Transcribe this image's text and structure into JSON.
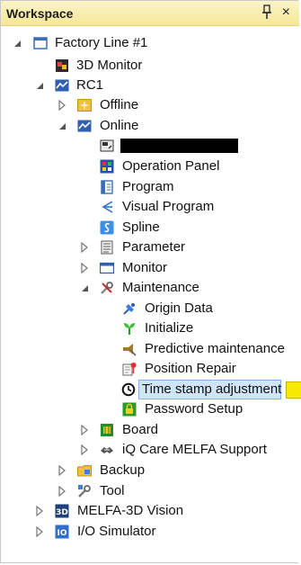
{
  "panel": {
    "title": "Workspace",
    "pin_icon": "pin-icon",
    "close_glyph": "×"
  },
  "tree": {
    "factory_line": "Factory Line #1",
    "monitor_3d": "3D Monitor",
    "rc1": "RC1",
    "offline": "Offline",
    "online": "Online",
    "operation_panel": "Operation Panel",
    "program": "Program",
    "visual_program": "Visual Program",
    "spline": "Spline",
    "parameter": "Parameter",
    "monitor": "Monitor",
    "maintenance": "Maintenance",
    "origin_data": "Origin Data",
    "initialize": "Initialize",
    "predictive_maintenance": "Predictive maintenance",
    "position_repair": "Position Repair",
    "time_stamp_adjustment": "Time stamp adjustment",
    "password_setup": "Password Setup",
    "board": "Board",
    "iq_care": "iQ Care MELFA Support",
    "backup": "Backup",
    "tool": "Tool",
    "melfa_3d_vision": "MELFA-3D Vision",
    "io_simulator": "I/O Simulator"
  },
  "selected_item": "time_stamp_adjustment",
  "colors": {
    "header_bg": "#f6e79a",
    "selection_bg": "#cfe5f8",
    "selection_border": "#7eb4ea",
    "highlight_marker": "#f7ea00"
  }
}
